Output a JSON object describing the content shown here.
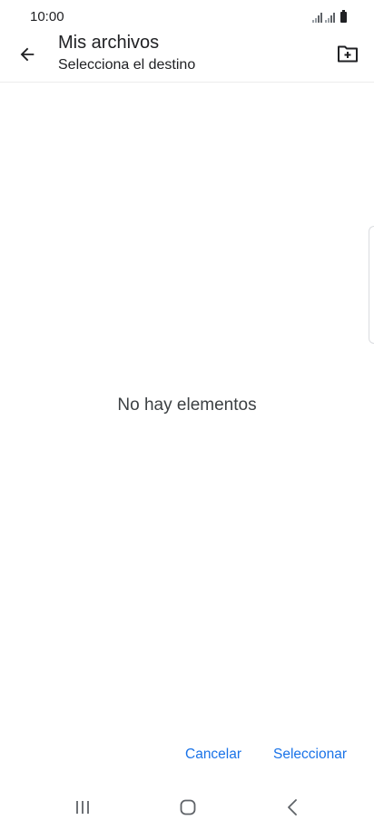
{
  "status_bar": {
    "time": "10:00"
  },
  "app_bar": {
    "title": "Mis archivos",
    "subtitle": "Selecciona el destino",
    "back_icon": "arrow-left-icon",
    "action_icon": "new-folder-icon"
  },
  "content": {
    "empty_message": "No hay elementos"
  },
  "actions": {
    "cancel_label": "Cancelar",
    "select_label": "Seleccionar"
  },
  "nav_bar": {
    "recents_icon": "recents-icon",
    "home_icon": "home-icon",
    "back_icon": "back-chevron-icon"
  },
  "colors": {
    "accent": "#1a73e8",
    "text_primary": "#202124",
    "background": "#ffffff"
  }
}
